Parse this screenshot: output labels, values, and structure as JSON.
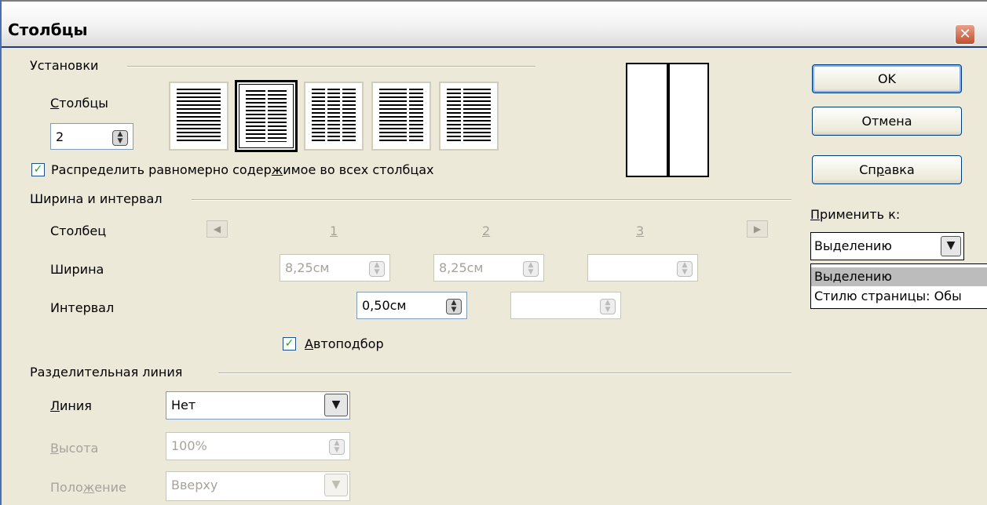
{
  "window": {
    "title": "Столбцы",
    "close_icon": "close-icon"
  },
  "settings": {
    "group_label": "Установки",
    "columns_label_first": "С",
    "columns_label_rest": "толбцы",
    "columns_value": "2",
    "layouts": [
      "1 столбец",
      "2 столбца",
      "3 столбца",
      "2 столбца, левый больше",
      "2 столбца, правый больше"
    ],
    "selected_layout_index": 1,
    "distribute_label_a": "Распределить равномерно содер",
    "distribute_label_u": "ж",
    "distribute_label_b": "имое во всех столбцах",
    "distribute_checked": true
  },
  "width_spacing": {
    "group_label": "Ширина и интервал",
    "column_label": "Столбец",
    "col_numbers": [
      "1",
      "2",
      "3"
    ],
    "width_label": "Ширина",
    "width_values": [
      "8,25см",
      "8,25см",
      ""
    ],
    "spacing_label": "Интервал",
    "spacing_values": [
      "0,50см",
      ""
    ],
    "autofit_label_u": "А",
    "autofit_label_rest": "втоподбор",
    "autofit_checked": true
  },
  "separator": {
    "group_label": "Разделительная линия",
    "line_label_u": "Л",
    "line_label_rest": "иния",
    "line_value": "Нет",
    "height_label_u": "В",
    "height_label_rest": "ысота",
    "height_value": "100%",
    "position_label_a": "Поло",
    "position_label_u": "ж",
    "position_label_b": "ение",
    "position_value": "Вверху"
  },
  "buttons": {
    "ok": "OK",
    "cancel": "Отмена",
    "help_a": "Сп",
    "help_u": "р",
    "help_b": "авка"
  },
  "apply_to": {
    "label_u": "П",
    "label_rest": "рименить к:",
    "value": "Выделению",
    "options": [
      "Выделению",
      "Стилю страницы: Обы"
    ],
    "selected_option_index": 0
  },
  "colors": {
    "title_bar_edge": "#1f3d7a",
    "dialog_bg": "#ece9d8",
    "close_button": "#c0502e",
    "check": "#21a121"
  }
}
